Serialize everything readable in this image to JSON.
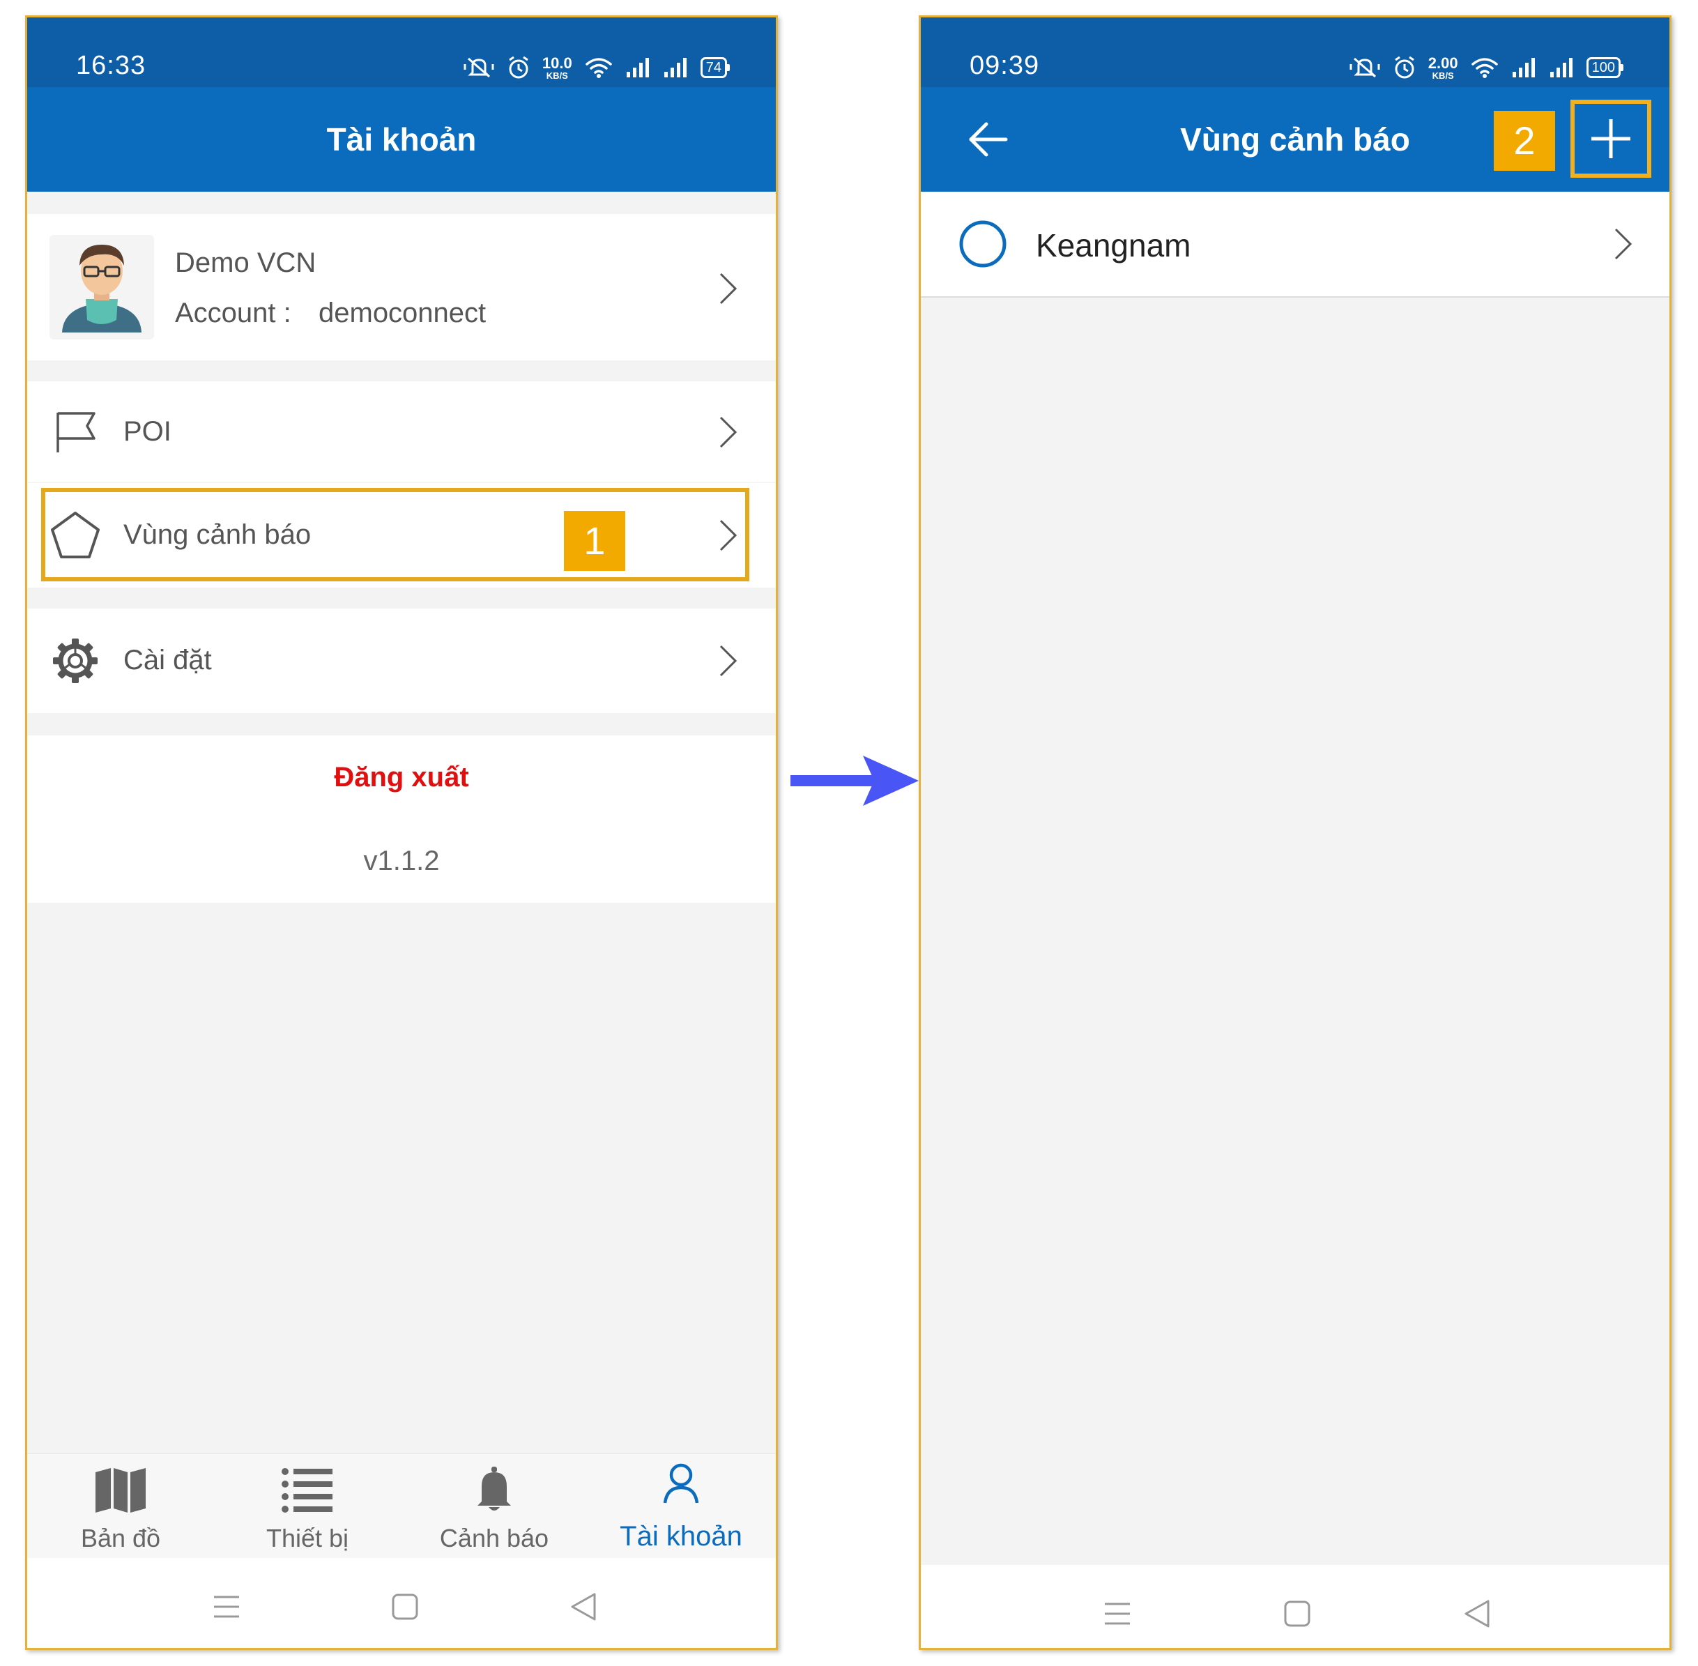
{
  "left": {
    "status": {
      "time": "16:33",
      "speed_value": "10.0",
      "speed_unit": "KB/S",
      "battery": "74"
    },
    "header_title": "Tài khoản",
    "profile": {
      "name": "Demo VCN",
      "account_label": "Account :",
      "account_value": "democonnect"
    },
    "menu": [
      {
        "label": "POI",
        "icon": "flag-icon"
      },
      {
        "label": "Vùng cảnh báo",
        "icon": "pentagon-icon",
        "badge": "1"
      },
      {
        "label": "Cài đặt",
        "icon": "gear-icon"
      }
    ],
    "logout_label": "Đăng xuất",
    "version": "v1.1.2",
    "bottom_nav": [
      {
        "label": "Bản đồ",
        "icon": "map-icon"
      },
      {
        "label": "Thiết bị",
        "icon": "list-icon"
      },
      {
        "label": "Cảnh báo",
        "icon": "bell-icon"
      },
      {
        "label": "Tài khoản",
        "icon": "person-icon"
      }
    ]
  },
  "right": {
    "status": {
      "time": "09:39",
      "speed_value": "2.00",
      "speed_unit": "KB/S",
      "battery": "100"
    },
    "header_title": "Vùng cảnh báo",
    "badge": "2",
    "zones": [
      {
        "name": "Keangnam"
      }
    ]
  },
  "colors": {
    "primary": "#0b6bbd",
    "statusbar": "#0d5ea6",
    "highlight": "#e3a81c",
    "badge": "#f2a900",
    "logout": "#e01010",
    "arrow": "#4a55f5"
  }
}
